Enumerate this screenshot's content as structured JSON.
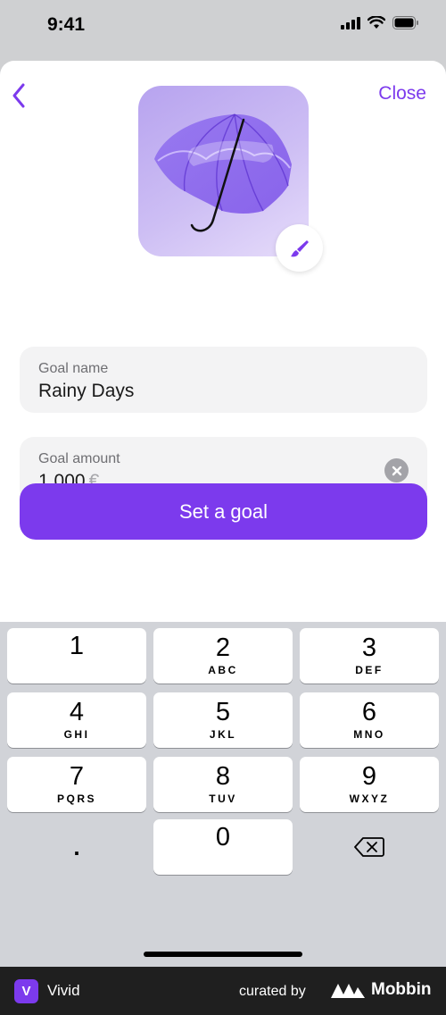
{
  "status_bar": {
    "time": "9:41"
  },
  "header": {
    "close_label": "Close"
  },
  "goal_name": {
    "label": "Goal name",
    "value": "Rainy Days"
  },
  "goal_amount": {
    "label": "Goal amount",
    "value": "1 000",
    "currency": "€"
  },
  "primary_button": {
    "label": "Set a goal"
  },
  "keypad": {
    "keys": [
      {
        "digit": "1",
        "letters": ""
      },
      {
        "digit": "2",
        "letters": "ABC"
      },
      {
        "digit": "3",
        "letters": "DEF"
      },
      {
        "digit": "4",
        "letters": "GHI"
      },
      {
        "digit": "5",
        "letters": "JKL"
      },
      {
        "digit": "6",
        "letters": "MNO"
      },
      {
        "digit": "7",
        "letters": "PQRS"
      },
      {
        "digit": "8",
        "letters": "TUV"
      },
      {
        "digit": "9",
        "letters": "WXYZ"
      },
      {
        "digit": "0",
        "letters": ""
      }
    ],
    "decimal": "."
  },
  "footer": {
    "app_initial": "V",
    "app_name": "Vivid",
    "curated_by": "curated by",
    "brand": "Mobbin"
  },
  "colors": {
    "accent": "#7c3aed",
    "sheet": "#ffffff",
    "field_background": "#f3f3f4",
    "keypad_background": "#d1d3d8",
    "footer_background": "#1f1f1f"
  },
  "icons": {
    "back": "chevron-left-icon",
    "edit_image": "paintbrush-icon",
    "clear": "clear-circle-icon",
    "delete": "backspace-icon"
  }
}
